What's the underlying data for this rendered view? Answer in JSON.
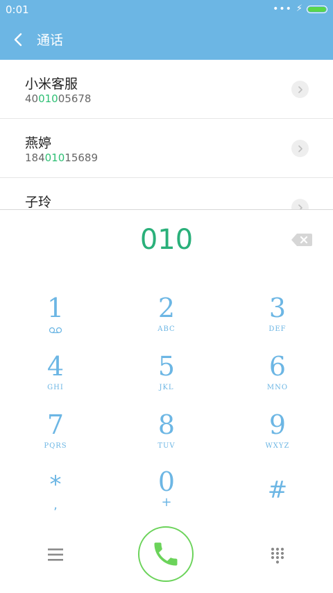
{
  "status": {
    "time": "0:01",
    "dots": "•••",
    "bolt": "⚡"
  },
  "header": {
    "title": "通话"
  },
  "results": [
    {
      "name": "小米客服",
      "number_pre": "40",
      "number_match": "010",
      "number_post": "05678"
    },
    {
      "name": "燕婷",
      "number_pre": "184",
      "number_match": "010",
      "number_post": "15689"
    },
    {
      "name": "子玲",
      "number_pre": "",
      "number_match": "",
      "number_post": ""
    }
  ],
  "dialer": {
    "input": "010",
    "keys": [
      {
        "digit": "1",
        "letters": ""
      },
      {
        "digit": "2",
        "letters": "ABC"
      },
      {
        "digit": "3",
        "letters": "DEF"
      },
      {
        "digit": "4",
        "letters": "GHI"
      },
      {
        "digit": "5",
        "letters": "JKL"
      },
      {
        "digit": "6",
        "letters": "MNO"
      },
      {
        "digit": "7",
        "letters": "PQRS"
      },
      {
        "digit": "8",
        "letters": "TUV"
      },
      {
        "digit": "9",
        "letters": "WXYZ"
      },
      {
        "digit": "*",
        "letters": ","
      },
      {
        "digit": "0",
        "letters": "+"
      },
      {
        "digit": "#",
        "letters": ""
      }
    ]
  },
  "colors": {
    "accent": "#6cb6e4",
    "match": "#2dbf73",
    "call": "#6bd35a",
    "battery": "#5ad64a"
  },
  "icons": [
    "back-arrow-icon",
    "chevron-right-icon",
    "backspace-icon",
    "voicemail-icon",
    "menu-icon",
    "phone-icon",
    "keypad-icon"
  ]
}
